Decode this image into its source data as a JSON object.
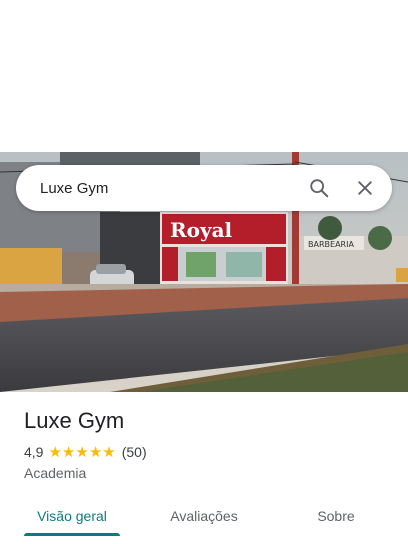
{
  "search": {
    "query": "Luxe Gym"
  },
  "place": {
    "name": "Luxe Gym",
    "rating": "4,9",
    "rating_stars": 5,
    "review_count": "(50)",
    "category": "Academia"
  },
  "photo": {
    "sign_main": "Royal",
    "sign_side": "BARBEARIA"
  },
  "tabs": [
    {
      "label": "Visão geral",
      "active": true
    },
    {
      "label": "Avaliações",
      "active": false
    },
    {
      "label": "Sobre",
      "active": false
    }
  ],
  "colors": {
    "star": "#fbbc04",
    "active_tab": "#0b7a88",
    "text_primary": "#202124",
    "text_secondary": "#5f6368"
  }
}
